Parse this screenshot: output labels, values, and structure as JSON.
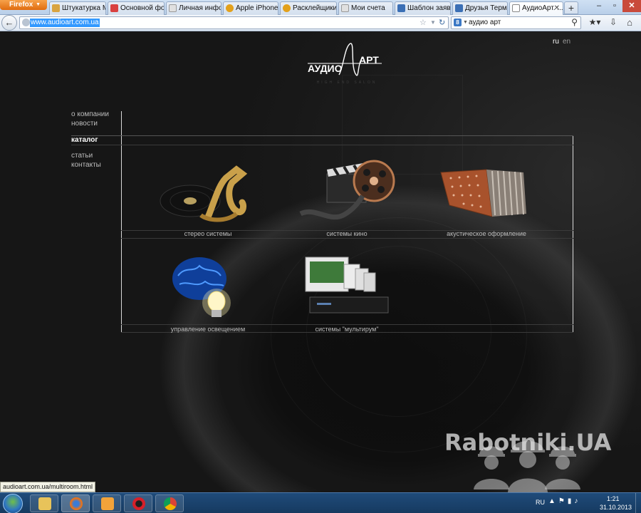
{
  "browser": {
    "app_button": "Firefox",
    "tabs": [
      {
        "title": "Штукатурка М...",
        "icon_color": "#d9a441"
      },
      {
        "title": "Основной фо...",
        "icon_color": "#d94141"
      },
      {
        "title": "Личная инфо...",
        "icon_color": "#e0e0e0"
      },
      {
        "title": "Apple iPhone ...",
        "icon_color": "#e3a11c"
      },
      {
        "title": "Расклейщики...",
        "icon_color": "#e3a11c"
      },
      {
        "title": "Мои счета",
        "icon_color": "#e0e0e0"
      },
      {
        "title": "Шаблон заявл...",
        "icon_color": "#3b6fb5"
      },
      {
        "title": "Друзья Термо...",
        "icon_color": "#3b6fb5"
      },
      {
        "title": "АудиоАрт. ...",
        "icon_color": "#ffffff",
        "active": true
      }
    ],
    "new_tab": "+",
    "url": "www.audioart.com.ua",
    "search_query": "аудио арт",
    "search_engine_letter": "8"
  },
  "page": {
    "lang": {
      "ru": "ru",
      "en": "en"
    },
    "logo": {
      "left": "АУДИО",
      "right": "АРТ",
      "tagline": "HIGH END SALON"
    },
    "nav": [
      {
        "label": "о компании"
      },
      {
        "label": "новости"
      },
      {
        "label": "каталог",
        "active": true
      },
      {
        "label": "статьи"
      },
      {
        "label": "контакты"
      }
    ],
    "categories": [
      {
        "label": "стерео системы"
      },
      {
        "label": "системы кино"
      },
      {
        "label": "акустическое оформление"
      },
      {
        "label": "управление освещением"
      },
      {
        "label": "системы \"мультирум\""
      }
    ],
    "watermark": "Rabotniki.UA"
  },
  "status_bar": {
    "link": "audioart.com.ua/multiroom.html"
  },
  "taskbar": {
    "lang": "RU",
    "time": "1:21",
    "date": "31.10.2013"
  },
  "colors": {
    "accent_url_selection": "#3399ff",
    "page_bg": "#1b1b1b"
  }
}
